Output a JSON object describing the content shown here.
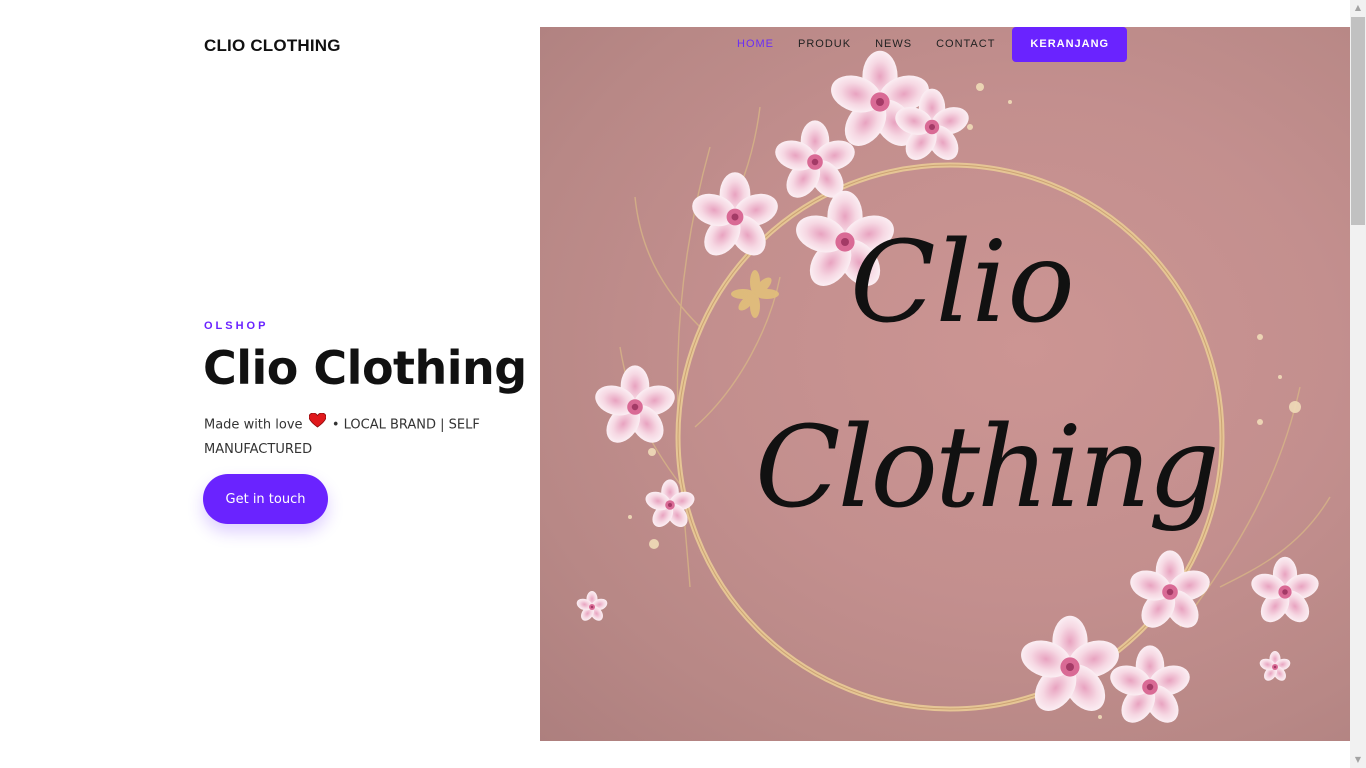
{
  "header": {
    "brand": "CLIO CLOTHING"
  },
  "nav": {
    "items": [
      {
        "label": "HOME",
        "active": true
      },
      {
        "label": "PRODUK",
        "active": false
      },
      {
        "label": "NEWS",
        "active": false
      },
      {
        "label": "CONTACT",
        "active": false
      }
    ],
    "cart_label": "KERANJANG"
  },
  "hero": {
    "eyebrow": "OLSHOP",
    "title": "Clio Clothing",
    "tagline_prefix": "Made with love",
    "heart_icon": "red-heart-emoji",
    "tagline_suffix": "• LOCAL BRAND | SELF MANUFACTURED",
    "cta_label": "Get in touch",
    "image": {
      "script_line1": "Clio",
      "script_line2": "Clothing",
      "background_color": "#c38f8e"
    }
  },
  "colors": {
    "accent": "#6a23ff",
    "text_dark": "#111111"
  }
}
